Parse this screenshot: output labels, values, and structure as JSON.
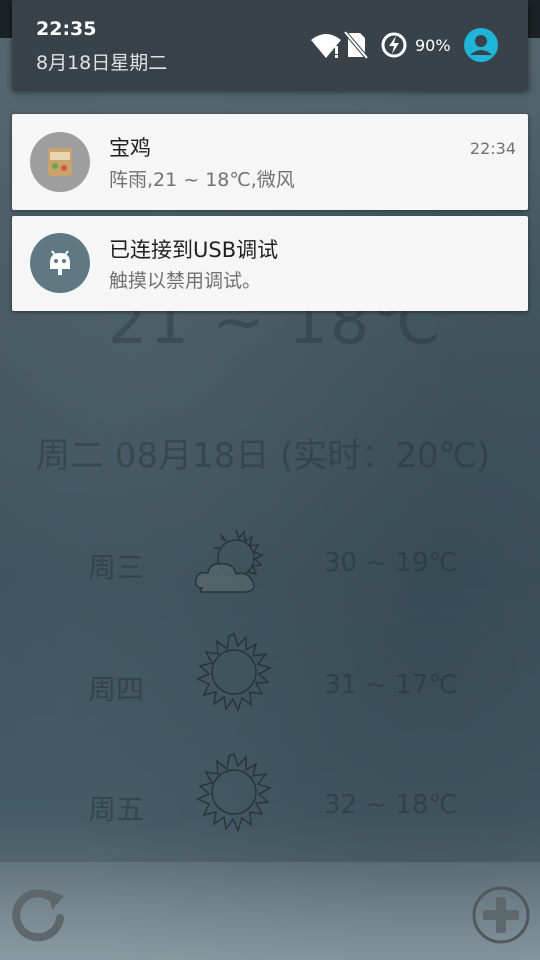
{
  "status": {
    "time": "22:35",
    "date": "8月18日星期二",
    "battery_percent": "90%",
    "icons": [
      "wifi-icon",
      "no-sim-icon",
      "battery-charging-icon",
      "account-icon"
    ]
  },
  "notifications": [
    {
      "title": "宝鸡",
      "text": "阵雨,21 ~ 18℃,微风",
      "time": "22:34",
      "icon": "weather-app-icon"
    },
    {
      "title": "已连接到USB调试",
      "text": "触摸以禁用调试。",
      "icon": "android-debug-icon"
    }
  ],
  "weather": {
    "today_range": "21 ~ 18℃",
    "date_line": "周二 08月18日 (实时：20℃)",
    "forecast": [
      {
        "day": "周三",
        "range": "30 ~ 19℃",
        "icon": "cloudy-sun-icon"
      },
      {
        "day": "周四",
        "range": "31 ~ 17℃",
        "icon": "sun-icon"
      },
      {
        "day": "周五",
        "range": "32 ~ 18℃",
        "icon": "sun-icon"
      }
    ]
  },
  "toolbar": {
    "icons": [
      "refresh-icon",
      "add-icon"
    ]
  }
}
